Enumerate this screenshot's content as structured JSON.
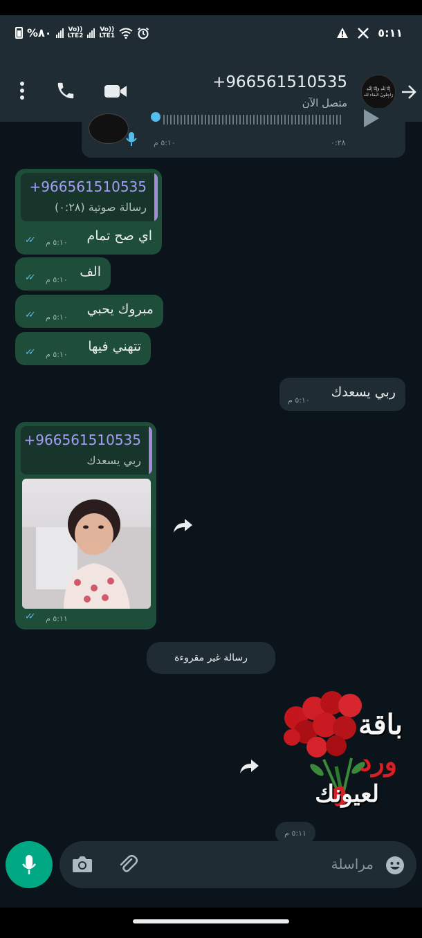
{
  "status_bar": {
    "battery": "%٨٠",
    "sim1": {
      "top": "Vo))",
      "bottom": "LTE2"
    },
    "sim2": {
      "top": "Vo))",
      "bottom": "LTE1"
    },
    "time": "٥:١١"
  },
  "header": {
    "contact_name": "+966561510535",
    "contact_status": "متصل الآن",
    "avatar_text": "إِنَّا لِلَّهِ وَإِنَّا إِلَيْهِ رَاجِعُونَ البقاء لله"
  },
  "messages": {
    "voice_top": {
      "time": "٥:١٠ م",
      "duration": "٠:٢٨"
    },
    "m1": {
      "quote_name": "+966561510535",
      "quote_text": "رسالة صوتية (٠:٢٨)",
      "text": "اي صح تمام",
      "time": "٥:١٠ م"
    },
    "m2": {
      "text": "الف",
      "time": "٥:١٠ م"
    },
    "m3": {
      "text": "مبروك يحبي",
      "time": "٥:١٠ م"
    },
    "m4": {
      "text": "تتهني فيها",
      "time": "٥:١٠ م"
    },
    "m5": {
      "text": "ربي يسعدك",
      "time": "٥:١٠ م"
    },
    "m6": {
      "quote_name": "+966561510535",
      "quote_text": "ربي يسعدك",
      "time": "٥:١١ م"
    },
    "unread_divider": "رسالة غير مقروءة",
    "sticker": {
      "line1": "باقة",
      "line2": "ورد",
      "line3": "لعيونك",
      "time": "٥:١١ م"
    }
  },
  "composer": {
    "placeholder": "مراسلة"
  },
  "colors": {
    "accent": "#00a884",
    "outgoing_bubble": "#1e4d3a",
    "incoming_bubble": "#202c33",
    "read_ticks": "#53bdeb"
  }
}
